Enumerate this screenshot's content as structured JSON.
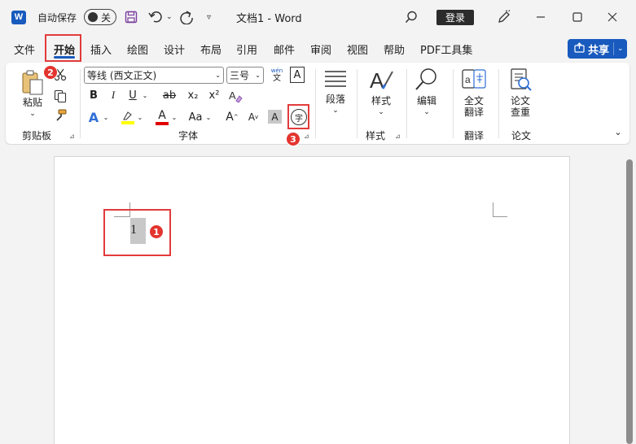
{
  "titlebar": {
    "autosave_label": "自动保存",
    "autosave_state": "关",
    "doc_title": "文档1  -  Word",
    "login_label": "登录",
    "logo_letter": "W"
  },
  "tabs": [
    "文件",
    "开始",
    "插入",
    "绘图",
    "设计",
    "布局",
    "引用",
    "邮件",
    "审阅",
    "视图",
    "帮助",
    "PDF工具集"
  ],
  "share": {
    "label": "共享"
  },
  "ribbon": {
    "clipboard": {
      "paste_label": "粘贴",
      "group_label": "剪贴板"
    },
    "font": {
      "font_name": "等线 (西文正文)",
      "font_size": "三号",
      "pinyin_top": "wén",
      "pinyin_bottom": "文",
      "border_char": "A",
      "bold": "B",
      "italic": "I",
      "underline": "U",
      "strike": "ab",
      "subscript": "x₂",
      "superscript": "x²",
      "text_effects": "A",
      "font_color": "A",
      "change_case": "Aa",
      "grow": "A",
      "shrink": "A",
      "shading_char": "A",
      "enclose_char": "字",
      "group_label": "字体",
      "highlight_color": "#ffff00",
      "font_color_value": "#e00000"
    },
    "paragraph": {
      "label": "段落"
    },
    "styles": {
      "label": "样式",
      "group_label": "样式"
    },
    "editing": {
      "label": "编辑"
    },
    "translate": {
      "label_line1": "全文",
      "label_line2": "翻译",
      "group_label": "翻译"
    },
    "paper": {
      "label_line1": "论文",
      "label_line2": "查重",
      "group_label": "论文"
    }
  },
  "document": {
    "selected_text": "1"
  },
  "annotations": {
    "badge1": "1",
    "badge2": "2",
    "badge3": "3"
  }
}
